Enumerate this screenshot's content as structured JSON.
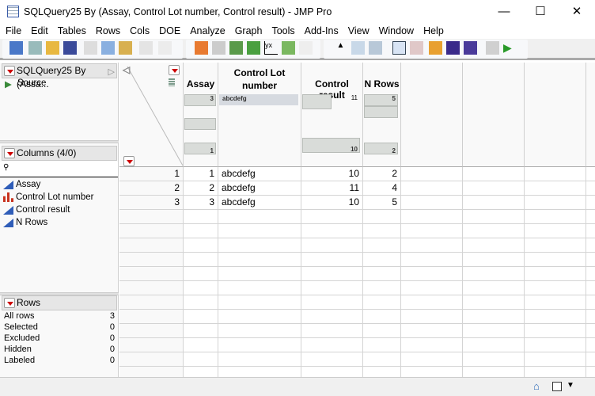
{
  "window": {
    "title": "SQLQuery25 By (Assay, Control Lot number, Control result) - JMP Pro",
    "minimize": "—",
    "maximize": "☐",
    "close": "✕"
  },
  "menu": [
    "File",
    "Edit",
    "Tables",
    "Rows",
    "Cols",
    "DOE",
    "Analyze",
    "Graph",
    "Tools",
    "Add-Ins",
    "View",
    "Window",
    "Help"
  ],
  "table_panel": {
    "title": "SQLQuery25 By (Assa...",
    "items": [
      {
        "label": "Source"
      }
    ]
  },
  "columns_panel": {
    "title": "Columns (4/0)",
    "search_placeholder": "",
    "columns": [
      {
        "name": "Assay",
        "type": "continuous"
      },
      {
        "name": "Control Lot number",
        "type": "nominal"
      },
      {
        "name": "Control result",
        "type": "continuous"
      },
      {
        "name": "N Rows",
        "type": "continuous"
      }
    ]
  },
  "rows_panel": {
    "title": "Rows",
    "items": [
      {
        "label": "All rows",
        "value": "3"
      },
      {
        "label": "Selected",
        "value": "0"
      },
      {
        "label": "Excluded",
        "value": "0"
      },
      {
        "label": "Hidden",
        "value": "0"
      },
      {
        "label": "Labeled",
        "value": "0"
      }
    ]
  },
  "grid": {
    "headers": [
      "Assay",
      "Control Lot number",
      "Control result",
      "N Rows"
    ],
    "summaries": {
      "assay": {
        "max": "3",
        "min": "1"
      },
      "lot": {
        "level": "abcdefg"
      },
      "result": {
        "max": "11",
        "min": "10"
      },
      "nrows": {
        "max": "5",
        "min": "2"
      }
    },
    "rows": [
      {
        "n": "1",
        "cells": [
          "1",
          "abcdefg",
          "10",
          "2"
        ]
      },
      {
        "n": "2",
        "cells": [
          "2",
          "abcdefg",
          "11",
          "4"
        ]
      },
      {
        "n": "3",
        "cells": [
          "3",
          "abcdefg",
          "10",
          "5"
        ]
      }
    ]
  },
  "colors": {
    "accent_red": "#cc0000",
    "continuous_blue": "#2f5db8",
    "nominal_red": "#c8321e"
  }
}
